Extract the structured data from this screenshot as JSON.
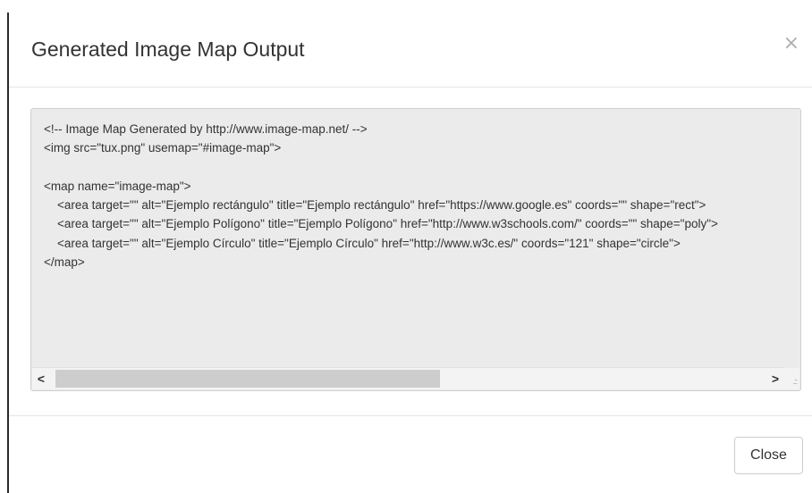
{
  "modal": {
    "title": "Generated Image Map Output",
    "close_icon": "×",
    "close_icon_name": "close-icon",
    "code": [
      "<!-- Image Map Generated by http://www.image-map.net/ -->",
      "<img src=\"tux.png\" usemap=\"#image-map\">",
      "",
      "<map name=\"image-map\">",
      "    <area target=\"\" alt=\"Ejemplo rectángulo\" title=\"Ejemplo rectángulo\" href=\"https://www.google.es\" coords=\"\" shape=\"rect\">",
      "    <area target=\"\" alt=\"Ejemplo Polígono\" title=\"Ejemplo Polígono\" href=\"http://www.w3schools.com/\" coords=\"\" shape=\"poly\">",
      "    <area target=\"\" alt=\"Ejemplo Círculo\" title=\"Ejemplo Círculo\" href=\"http://www.w3c.es/\" coords=\"121\" shape=\"circle\">",
      "</map>"
    ],
    "scrollbar": {
      "left_arrow": "<",
      "right_arrow": ">",
      "thumb_fraction": 0.52
    },
    "resize_grip": ".::",
    "close_button_label": "Close"
  },
  "colors": {
    "code_background": "#ebebeb",
    "title_text": "#333333",
    "close_icon": "#b0b0b0"
  }
}
